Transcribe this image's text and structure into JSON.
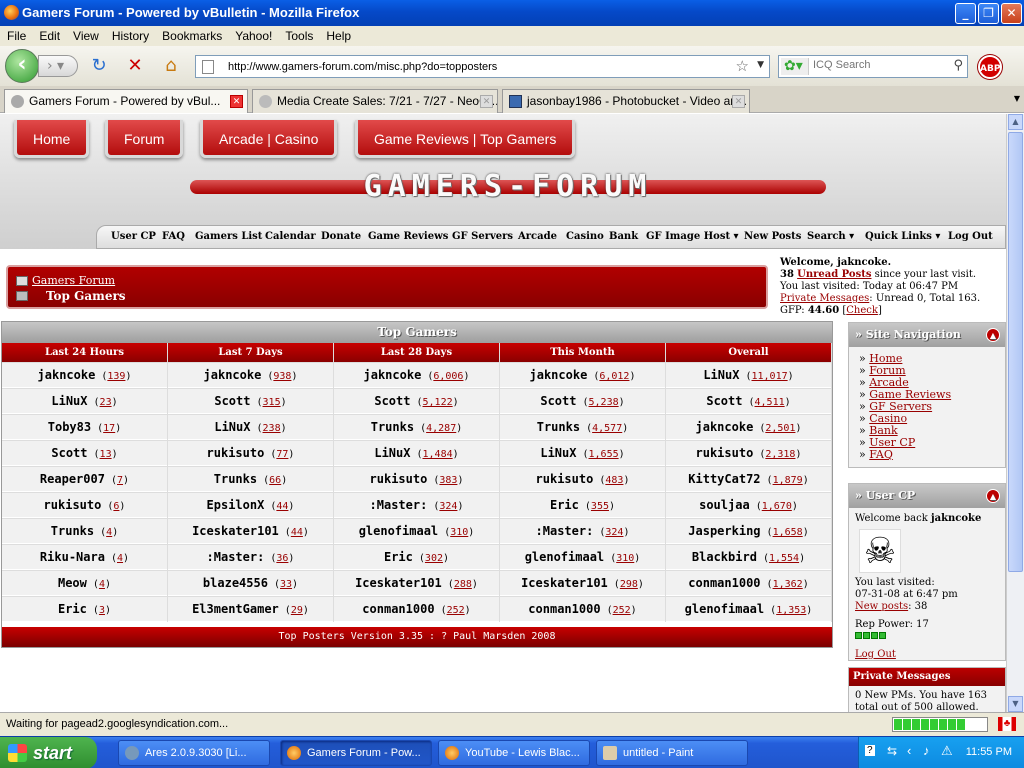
{
  "window": {
    "title": "Gamers Forum - Powered by vBulletin - Mozilla Firefox"
  },
  "menu": [
    "File",
    "Edit",
    "View",
    "History",
    "Bookmarks",
    "Yahoo!",
    "Tools",
    "Help"
  ],
  "address": {
    "url": "http://www.gamers-forum.com/misc.php?do=topposters"
  },
  "search": {
    "placeholder": "ICQ Search"
  },
  "abp_label": "ABP",
  "tabs": [
    {
      "label": "Gamers Forum - Powered by vBul..."
    },
    {
      "label": "Media Create Sales: 7/21 - 7/27 - NeoG..."
    },
    {
      "label": "jasonbay1986 - Photobucket - Video an..."
    }
  ],
  "site": {
    "top_nav": [
      "Home",
      "Forum",
      "Arcade | Casino",
      "Game Reviews | Top Gamers"
    ],
    "logo_text": "GAMERS-FORUM",
    "links": [
      "User CP",
      "FAQ",
      "Gamers List",
      "Calendar",
      "Donate",
      "Game Reviews",
      "GF Servers",
      "Arcade",
      "Casino",
      "Bank",
      "GF Image Host",
      "New Posts",
      "Search",
      "Quick Links",
      "Log Out"
    ],
    "breadcrumb": {
      "root": "Gamers Forum",
      "current": "Top Gamers"
    },
    "welcome": {
      "line1": "Welcome, jakncoke.",
      "unread_count": "38",
      "unread_label": "Unread Posts",
      "unread_suffix": " since your last visit.",
      "last_visited": "You last visited: Today at 06:47 PM",
      "pm_label": "Private Messages",
      "pm_text": ": Unread 0, Total 163.",
      "gfp_label": "GFP: ",
      "gfp_value": "44.60",
      "check": "Check"
    }
  },
  "top_gamers": {
    "title": "Top Gamers",
    "columns": [
      "Last 24 Hours",
      "Last 7 Days",
      "Last 28 Days",
      "This Month",
      "Overall"
    ],
    "rows": [
      [
        [
          "jakncoke",
          "139"
        ],
        [
          "jakncoke",
          "938"
        ],
        [
          "jakncoke",
          "6,006"
        ],
        [
          "jakncoke",
          "6,012"
        ],
        [
          "LiNuX",
          "11,017"
        ]
      ],
      [
        [
          "LiNuX",
          "23"
        ],
        [
          "Scott",
          "315"
        ],
        [
          "Scott",
          "5,122"
        ],
        [
          "Scott",
          "5,238"
        ],
        [
          "Scott",
          "4,511"
        ]
      ],
      [
        [
          "Toby83",
          "17"
        ],
        [
          "LiNuX",
          "238"
        ],
        [
          "Trunks",
          "4,287"
        ],
        [
          "Trunks",
          "4,577"
        ],
        [
          "jakncoke",
          "2,501"
        ]
      ],
      [
        [
          "Scott",
          "13"
        ],
        [
          "rukisuto",
          "77"
        ],
        [
          "LiNuX",
          "1,484"
        ],
        [
          "LiNuX",
          "1,655"
        ],
        [
          "rukisuto",
          "2,318"
        ]
      ],
      [
        [
          "Reaper007",
          "7"
        ],
        [
          "Trunks",
          "66"
        ],
        [
          "rukisuto",
          "383"
        ],
        [
          "rukisuto",
          "483"
        ],
        [
          "KittyCat72",
          "1,879"
        ]
      ],
      [
        [
          "rukisuto",
          "6"
        ],
        [
          "EpsilonX",
          "44"
        ],
        [
          ":Master:",
          "324"
        ],
        [
          "Eric",
          "355"
        ],
        [
          "souljaa",
          "1,670"
        ]
      ],
      [
        [
          "Trunks",
          "4"
        ],
        [
          "Iceskater101",
          "44"
        ],
        [
          "glenofimaal",
          "310"
        ],
        [
          ":Master:",
          "324"
        ],
        [
          "Jasperking",
          "1,658"
        ]
      ],
      [
        [
          "Riku-Nara",
          "4"
        ],
        [
          ":Master:",
          "36"
        ],
        [
          "Eric",
          "302"
        ],
        [
          "glenofimaal",
          "310"
        ],
        [
          "Blackbird",
          "1,554"
        ]
      ],
      [
        [
          "Meow",
          "4"
        ],
        [
          "blaze4556",
          "33"
        ],
        [
          "Iceskater101",
          "288"
        ],
        [
          "Iceskater101",
          "298"
        ],
        [
          "conman1000",
          "1,362"
        ]
      ],
      [
        [
          "Eric",
          "3"
        ],
        [
          "El3mentGamer",
          "29"
        ],
        [
          "conman1000",
          "252"
        ],
        [
          "conman1000",
          "252"
        ],
        [
          "glenofimaal",
          "1,353"
        ]
      ]
    ],
    "footer": "Top Posters Version 3.35 : ? Paul Marsden 2008"
  },
  "sidebar": {
    "site_nav": {
      "title": "Site Navigation",
      "items": [
        "Home",
        "Forum",
        "Arcade",
        "Game Reviews",
        "GF Servers",
        "Casino",
        "Bank",
        "User CP",
        "FAQ"
      ]
    },
    "user_cp": {
      "title": "User CP",
      "welcome_prefix": "Welcome back ",
      "username": "jakncoke",
      "last_visited_label": "You last visited:",
      "last_visited": "07-31-08 at 6:47 pm",
      "new_posts_label": "New posts",
      "new_posts_value": ": 38",
      "rep_power": "Rep Power: 17",
      "logout": "Log Out"
    },
    "pm": {
      "title": "Private Messages",
      "text": "0 New PMs. You have 163 total out of 500 allowed."
    }
  },
  "status": {
    "text": "Waiting for pagead2.googlesyndication.com...",
    "progress": 0.75
  },
  "taskbar": {
    "start": "start",
    "items": [
      "Ares 2.0.9.3030   [Li...",
      "Gamers Forum - Pow...",
      "YouTube - Lewis Blac...",
      "untitled - Paint"
    ],
    "clock": "11:55 PM"
  },
  "icons": [
    "firefox-icon",
    "back-arrow-icon",
    "forward-arrow-icon",
    "reload-icon",
    "stop-icon",
    "home-icon",
    "star-icon",
    "magnifier-icon",
    "skull-icon",
    "windows-flag-icon"
  ]
}
